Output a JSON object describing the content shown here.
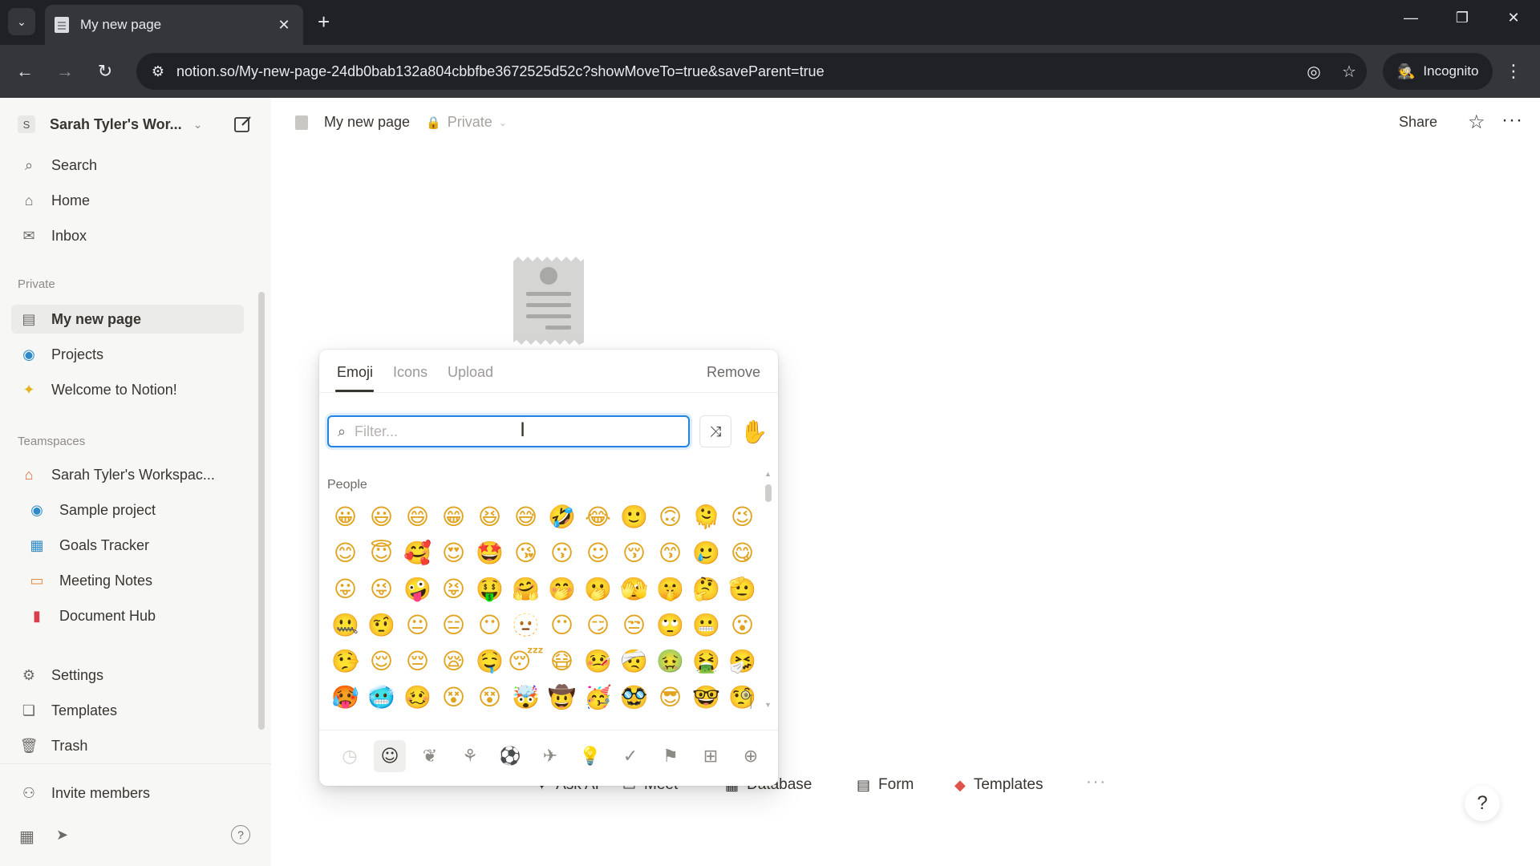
{
  "browser": {
    "tab_title": "My new page",
    "url": "notion.so/My-new-page-24db0bab132a804cbbfbe3672525d52c?showMoveTo=true&saveParent=true",
    "incognito_label": "Incognito",
    "icons": {
      "tab_menu": "⌄",
      "close": "✕",
      "new_tab": "+",
      "minimize": "—",
      "restore": "❐",
      "window_close": "✕",
      "back": "←",
      "forward": "→",
      "reload": "↻",
      "site_info": "⚙",
      "eye_off": "◎",
      "bookmark": "☆",
      "incognito": "🕵",
      "kebab": "⋮"
    }
  },
  "sidebar": {
    "workspace": {
      "avatar": "S",
      "name": "Sarah Tyler's Wor..."
    },
    "top_items": [
      {
        "label": "Search",
        "icon": "⌕"
      },
      {
        "label": "Home",
        "icon": "⌂"
      },
      {
        "label": "Inbox",
        "icon": "✉"
      }
    ],
    "private_heading": "Private",
    "private_items": [
      {
        "label": "My new page",
        "icon": "▤"
      },
      {
        "label": "Projects",
        "icon": "◉"
      },
      {
        "label": "Welcome to Notion!",
        "icon": "✦"
      }
    ],
    "teamspaces_heading": "Teamspaces",
    "teamspace": {
      "label": "Sarah Tyler's Workspac...",
      "icon": "⌂"
    },
    "team_items": [
      {
        "label": "Sample project",
        "icon": "◉"
      },
      {
        "label": "Goals Tracker",
        "icon": "▦"
      },
      {
        "label": "Meeting Notes",
        "icon": "▭"
      },
      {
        "label": "Document Hub",
        "icon": "▮"
      }
    ],
    "bottom_items": [
      {
        "label": "Settings",
        "icon": "⚙"
      },
      {
        "label": "Templates",
        "icon": "❏"
      },
      {
        "label": "Trash",
        "icon": "🗑"
      }
    ],
    "invite_label": "Invite members",
    "footer_icons": {
      "calendar": "▦",
      "send": "➤",
      "help": "?"
    }
  },
  "page": {
    "breadcrumb_title": "My new page",
    "visibility": "Private",
    "share_label": "Share",
    "quick_actions": [
      {
        "label": "Ask AI",
        "icon": "✦"
      },
      {
        "label": "Meet",
        "icon": "▭"
      },
      {
        "label": "Database",
        "icon": "▦"
      },
      {
        "label": "Form",
        "icon": "▤"
      },
      {
        "label": "Templates",
        "icon": "◆"
      }
    ],
    "help_icon": "?"
  },
  "emoji_picker": {
    "tabs": [
      "Emoji",
      "Icons",
      "Upload"
    ],
    "active_tab": "Emoji",
    "remove_label": "Remove",
    "search": {
      "placeholder": "Filter...",
      "value": ""
    },
    "shuffle_icon": "⤨",
    "skin_tone_emoji": "✋",
    "category_label": "People",
    "emojis": [
      "😀",
      "😃",
      "😄",
      "😁",
      "😆",
      "😅",
      "🤣",
      "😂",
      "🙂",
      "🙃",
      "🫠",
      "😉",
      "😊",
      "😇",
      "🥰",
      "😍",
      "🤩",
      "😘",
      "😗",
      "☺",
      "😚",
      "😙",
      "🥲",
      "😋",
      "😛",
      "😜",
      "🤪",
      "😝",
      "🤑",
      "🤗",
      "🤭",
      "🫢",
      "🫣",
      "🤫",
      "🤔",
      "🫡",
      "🤐",
      "🤨",
      "😐",
      "😑",
      "😶",
      "🫥",
      "😶",
      "😏",
      "😒",
      "🙄",
      "😬",
      "😮",
      "🤥",
      "😌",
      "😔",
      "😪",
      "🤤",
      "😴",
      "😷",
      "🤒",
      "🤕",
      "🤢",
      "🤮",
      "🤧",
      "🥵",
      "🥶",
      "🥴",
      "😵",
      "😵",
      "🤯",
      "🤠",
      "🥳",
      "🥸",
      "😎",
      "🤓",
      "🧐",
      "😕",
      "🫤",
      "😟",
      "🙁",
      "☹",
      "😮",
      "😯",
      "😲",
      "😳",
      "🥺",
      "🥹",
      "😦"
    ],
    "categories": [
      {
        "name": "recent",
        "glyph": "◷"
      },
      {
        "name": "people",
        "glyph": "☺"
      },
      {
        "name": "nature",
        "glyph": "❦"
      },
      {
        "name": "food",
        "glyph": "⚘"
      },
      {
        "name": "activity",
        "glyph": "⚽"
      },
      {
        "name": "travel",
        "glyph": "✈"
      },
      {
        "name": "objects",
        "glyph": "💡"
      },
      {
        "name": "symbols",
        "glyph": "✓"
      },
      {
        "name": "flags",
        "glyph": "⚑"
      },
      {
        "name": "custom",
        "glyph": "⊞"
      },
      {
        "name": "add",
        "glyph": "⊕"
      }
    ]
  },
  "colors": {
    "accent": "#2383e2",
    "sidebar_bg": "#f7f7f5",
    "chrome_dark": "#202124"
  }
}
